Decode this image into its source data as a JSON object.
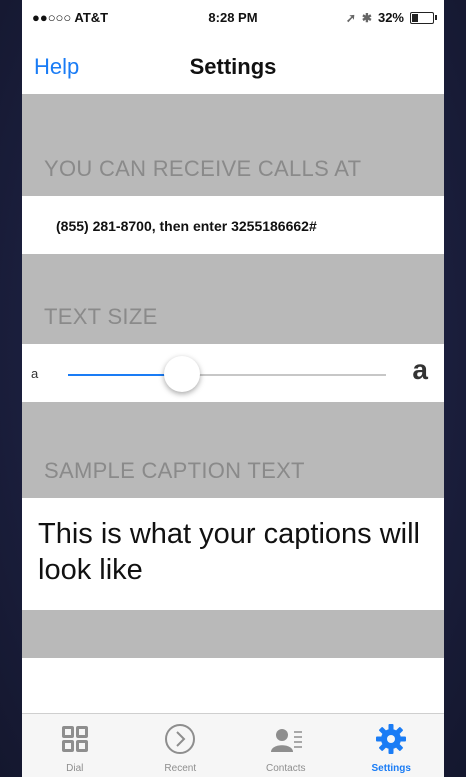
{
  "status_bar": {
    "carrier": "●●○○○ AT&T",
    "time": "8:28 PM",
    "battery": "32%",
    "battery_level": 0.32
  },
  "nav": {
    "left_button": "Help",
    "title": "Settings"
  },
  "sections": {
    "receive_calls": {
      "header": "YOU CAN RECEIVE CALLS AT",
      "value": "(855) 281-8700, then enter 3255186662#"
    },
    "text_size": {
      "header": "TEXT SIZE",
      "small_label": "a",
      "large_label": "a",
      "slider_level": 0.36
    },
    "sample_caption": {
      "header": "SAMPLE CAPTION TEXT",
      "text": "This is what your captions will look like"
    }
  },
  "tabbar": {
    "tabs": [
      {
        "label": "Dial",
        "icon": "dial-pad-icon",
        "active": false
      },
      {
        "label": "Recent",
        "icon": "recent-icon",
        "active": false
      },
      {
        "label": "Contacts",
        "icon": "contacts-icon",
        "active": false
      },
      {
        "label": "Settings",
        "icon": "gear-icon",
        "active": true
      }
    ],
    "accent_color": "#1a7cf5",
    "inactive_color": "#8e8e8e"
  }
}
